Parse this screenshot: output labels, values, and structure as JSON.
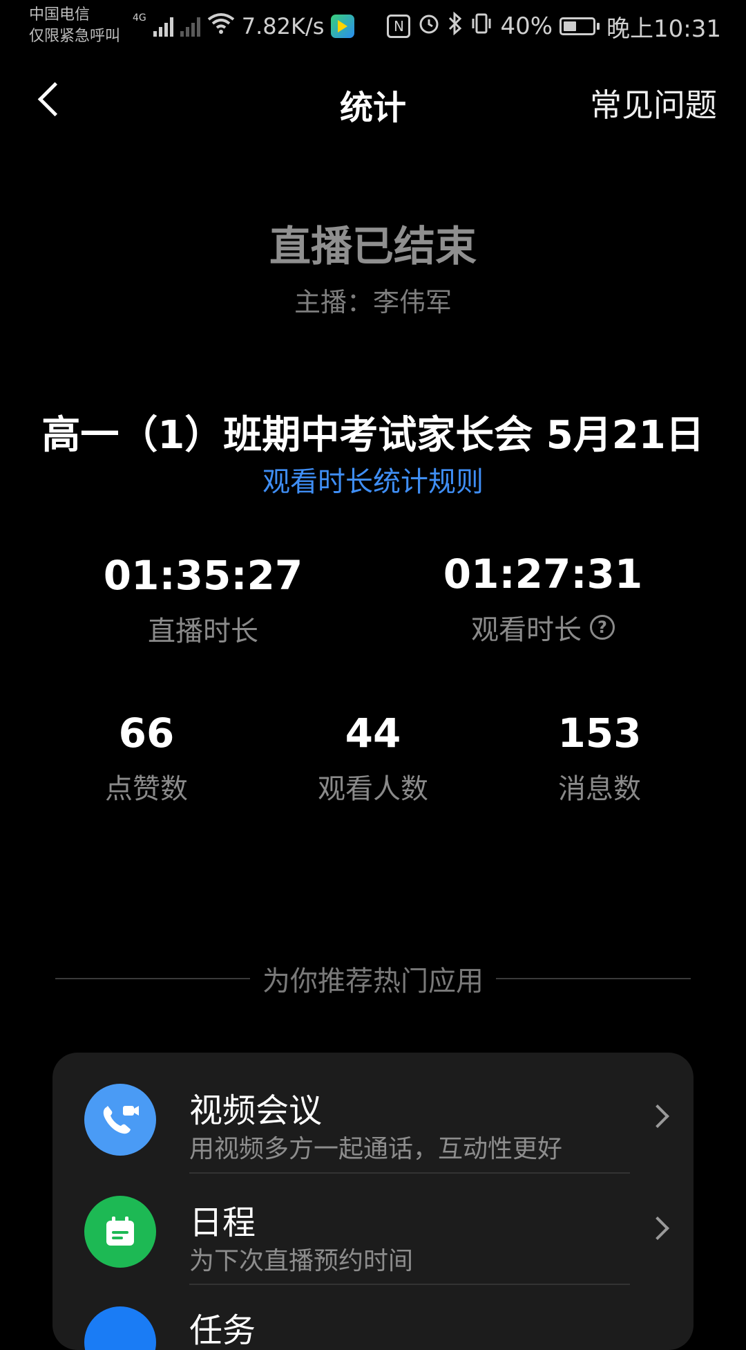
{
  "status_bar": {
    "carrier_line1": "中国电信",
    "carrier_line2": "仅限紧急呼叫",
    "network": "4G",
    "speed": "7.82K/s",
    "nfc": "N",
    "battery_percent": "40%",
    "time": "晚上10:31"
  },
  "nav": {
    "title": "统计",
    "faq": "常见问题"
  },
  "live": {
    "status": "直播已结束",
    "host_label": "主播：",
    "host_name": "李伟军",
    "title": "高一（1）班期中考试家长会 5月21日",
    "rules_link": "观看时长统计规则"
  },
  "stats": {
    "live_duration": {
      "value": "01:35:27",
      "label": "直播时长"
    },
    "watch_duration": {
      "value": "01:27:31",
      "label": "观看时长",
      "help_icon": "question-circle-icon"
    },
    "likes": {
      "value": "66",
      "label": "点赞数"
    },
    "viewers": {
      "value": "44",
      "label": "观看人数"
    },
    "messages": {
      "value": "153",
      "label": "消息数"
    }
  },
  "recommend": {
    "heading": "为你推荐热门应用",
    "apps": [
      {
        "name": "视频会议",
        "desc": "用视频多方一起通话，互动性更好",
        "icon": "video-call-icon",
        "color": "#4a9bf5"
      },
      {
        "name": "日程",
        "desc": "为下次直播预约时间",
        "icon": "calendar-icon",
        "color": "#1db954"
      },
      {
        "name": "任务",
        "desc": "",
        "icon": "task-icon",
        "color": "#1a7cf5"
      }
    ]
  },
  "colors": {
    "background": "#000000",
    "link": "#3f8ef5",
    "card": "#1c1c1c"
  }
}
